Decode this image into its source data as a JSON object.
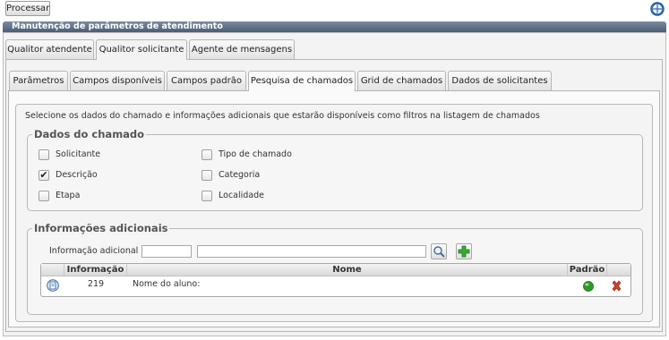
{
  "toolbar": {
    "process_label": "Processar"
  },
  "window": {
    "title": "Manutenção de parâmetros de atendimento"
  },
  "outer_tabs": [
    "Qualitor atendente",
    "Qualitor solicitante",
    "Agente de mensagens"
  ],
  "inner_tabs": [
    "Parâmetros",
    "Campos disponíveis",
    "Campos padrão",
    "Pesquisa de chamados",
    "Grid de chamados",
    "Dados de solicitantes"
  ],
  "description": "Selecione os dados do chamado e informações adicionais que estarão disponíveis como filtros na listagem de chamados",
  "dados_chamado": {
    "legend": "Dados do chamado",
    "options": [
      {
        "label": "Solicitante",
        "checked": false
      },
      {
        "label": "Descrição",
        "checked": true
      },
      {
        "label": "Etapa",
        "checked": false
      },
      {
        "label": "Tipo de chamado",
        "checked": false
      },
      {
        "label": "Categoria",
        "checked": false
      },
      {
        "label": "Localidade",
        "checked": false
      }
    ]
  },
  "informacoes": {
    "legend": "Informações adicionais",
    "field_label": "Informação adicional :",
    "code_value": "",
    "name_value": "",
    "grid": {
      "headers": [
        "Informação",
        "Nome",
        "Padrão"
      ],
      "rows": [
        {
          "informacao": "219",
          "nome": "Nome do aluno:"
        }
      ]
    }
  }
}
